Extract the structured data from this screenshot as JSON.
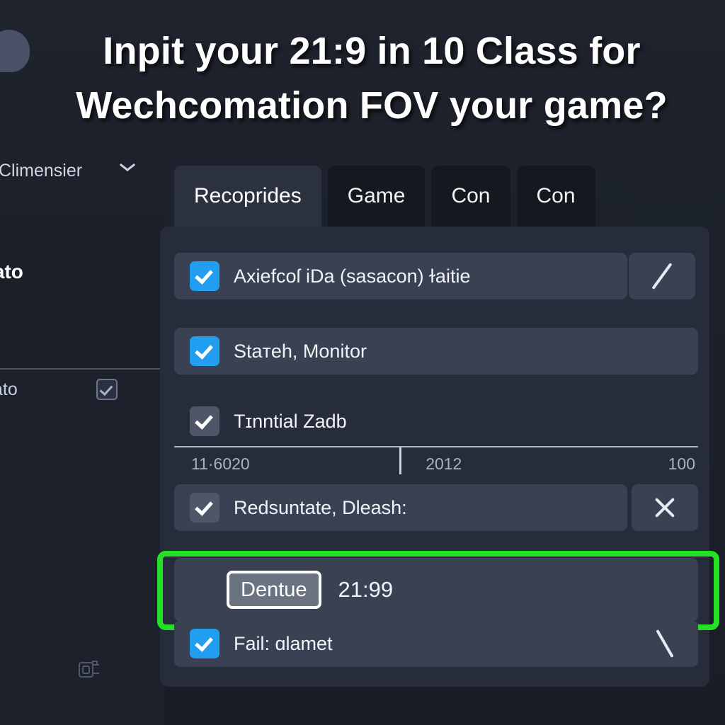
{
  "headline": "Inpit your 21:9  in 10 Class for\nWechcomation FOV your game?",
  "sidebar": {
    "select_label": "Climensier",
    "chevron_icon": "chevron-down-icon",
    "section_heading": "rato",
    "option_label": "ato",
    "option_checkbox_icon": "checkbox-checked-outline-icon",
    "mini_icon": "copy-document-icon"
  },
  "tabs": [
    {
      "label": "Recoprides",
      "active": true
    },
    {
      "label": "Game",
      "active": false
    },
    {
      "label": "Con",
      "active": false
    },
    {
      "label": "Con",
      "active": false
    }
  ],
  "rows": [
    {
      "label": "Axiefcoſ iDa (sasacon) ɫaitie",
      "checkbox": "checked-blue",
      "action_icon": "pencil-slash-icon"
    },
    {
      "label": "Staтeh, Monitor",
      "checkbox": "checked-blue",
      "action_icon": ""
    },
    {
      "label": "Tɪnntial Zadb",
      "checkbox": "checked-grey",
      "action_icon": ""
    },
    {
      "label": "Redsuntate, Dleash:",
      "checkbox": "checked-grey",
      "action_icon": "close-x-icon"
    },
    {
      "label": "Fail: ɑlamet",
      "checkbox": "checked-blue",
      "action_icon": "backslash-icon"
    }
  ],
  "scale": {
    "start_label": "11·6020",
    "mid_label": "2012",
    "end_label": "100",
    "tick_position_percent": 43
  },
  "highlighted_row": {
    "button_label": "Dentue",
    "value": "21:99",
    "highlight_color": "#26e026"
  },
  "colors": {
    "background": "#1b202a",
    "panel": "#262c3a",
    "row": "#3a4152",
    "checkbox_blue": "#229ef0",
    "checkbox_grey": "#4e5668",
    "highlight_green": "#26e026",
    "text_primary": "#f0f3f8",
    "text_muted": "#a8b0bf"
  }
}
